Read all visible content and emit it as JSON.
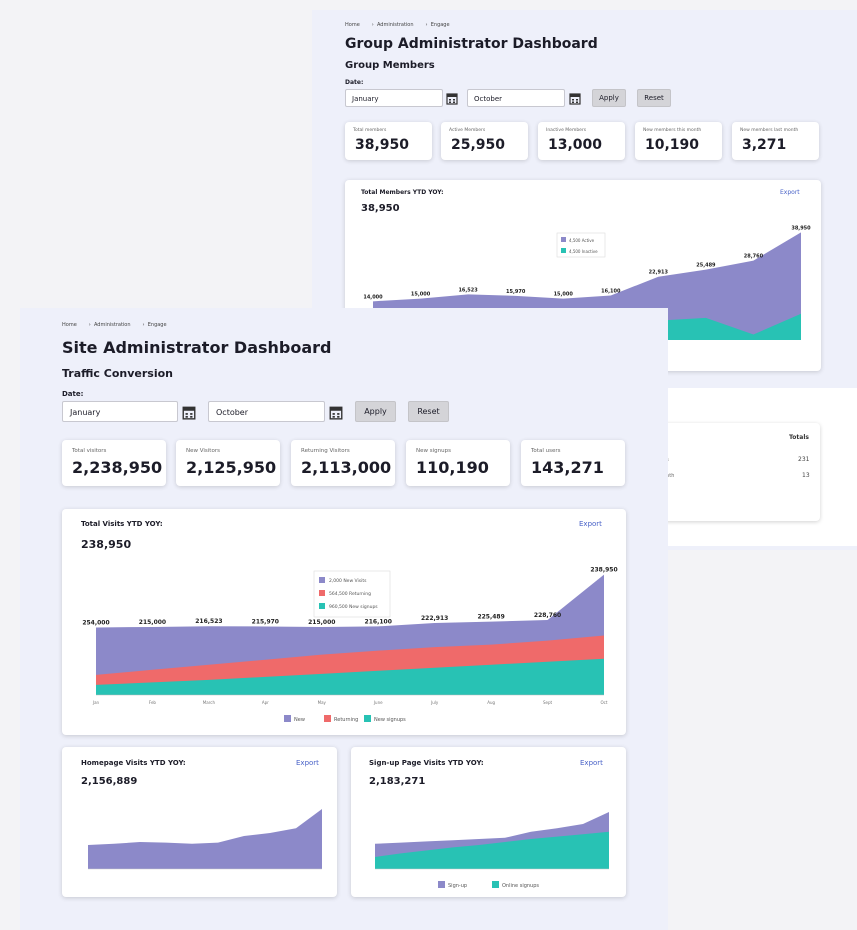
{
  "colors": {
    "purple": "#8c89c9",
    "red": "#ef6a6a",
    "teal": "#28c2b4",
    "link": "#4a63c8"
  },
  "back": {
    "breadcrumb": [
      "Home",
      "Administration",
      "Engage"
    ],
    "title": "Group Administrator Dashboard",
    "subtitle": "Group Members",
    "date_label": "Date:",
    "from": "January",
    "to": "October",
    "apply": "Apply",
    "reset": "Reset",
    "stats": [
      {
        "label": "Total members",
        "value": "38,950"
      },
      {
        "label": "Active Members",
        "value": "25,950"
      },
      {
        "label": "Inactive Members",
        "value": "13,000"
      },
      {
        "label": "New members this month",
        "value": "10,190"
      },
      {
        "label": "New members last month",
        "value": "3,271"
      }
    ],
    "chart_card": {
      "title": "Total Members YTD YOY:",
      "value": "38,950",
      "export": "Export"
    },
    "totals": {
      "header": "Totals",
      "row1": "231",
      "row2": "13",
      "row1_label": "ns",
      "row2_label": "onth"
    }
  },
  "front": {
    "breadcrumb": [
      "Home",
      "Administration",
      "Engage"
    ],
    "title": "Site Administrator Dashboard",
    "subtitle": "Traffic Conversion",
    "date_label": "Date:",
    "from": "January",
    "to": "October",
    "apply": "Apply",
    "reset": "Reset",
    "stats": [
      {
        "label": "Total visitors",
        "value": "2,238,950"
      },
      {
        "label": "New Visitors",
        "value": "2,125,950"
      },
      {
        "label": "Returning Visitors",
        "value": "2,113,000"
      },
      {
        "label": "New signups",
        "value": "110,190"
      },
      {
        "label": "Total users",
        "value": "143,271"
      }
    ],
    "main_card": {
      "title": "Total Visits YTD YOY:",
      "value": "238,950",
      "export": "Export"
    },
    "home_card": {
      "title": "Homepage Visits YTD YOY:",
      "value": "2,156,889",
      "export": "Export"
    },
    "signup_card": {
      "title": "Sign-up Page Visits YTD YOY:",
      "value": "2,183,271",
      "export": "Export"
    }
  },
  "chart_data": [
    {
      "type": "area",
      "title": "Total Members YTD YOY:",
      "x": [
        "",
        "",
        "",
        "",
        "",
        "",
        "",
        "",
        "",
        ""
      ],
      "series": [
        {
          "values": [
            14000,
            15000,
            16523,
            15970,
            15000,
            16100,
            22913,
            25489,
            28760,
            38950
          ]
        },
        {
          "values": [
            4000,
            4500,
            5200,
            5000,
            4800,
            6000,
            7000,
            8000,
            2000,
            9500
          ]
        }
      ],
      "data_labels": [
        "14,000",
        "15,000",
        "16,523",
        "15,970",
        "15,000",
        "16,100",
        "22,913",
        "25,489",
        "28,760",
        "38,950"
      ],
      "legend": [
        "4,500 Active",
        "4,500 Inactive"
      ],
      "legend_position": "top-center",
      "ylim": [
        0,
        42000
      ]
    },
    {
      "type": "area",
      "title": "Total Visits YTD YOY:",
      "x": [
        "Jan",
        "Feb",
        "March",
        "Apr",
        "May",
        "June",
        "July",
        "Aug",
        "Sept",
        "Oct"
      ],
      "series": [
        {
          "name": "New",
          "values": [
            134000,
            135000,
            136523,
            135970,
            135000,
            136100,
            142913,
            145489,
            148760,
            238950
          ]
        },
        {
          "name": "Returning",
          "values": [
            40000,
            50000,
            60000,
            70000,
            80000,
            88000,
            95000,
            100000,
            108000,
            118000
          ]
        },
        {
          "name": "New signups",
          "values": [
            20000,
            25000,
            30000,
            36000,
            42000,
            48000,
            54000,
            60000,
            66000,
            72000
          ]
        }
      ],
      "data_labels": [
        "254,000",
        "215,000",
        "216,523",
        "215,970",
        "215,000",
        "216,100",
        "222,913",
        "225,489",
        "228,760",
        "238,950"
      ],
      "legend_box": [
        "2,000 New Visits",
        "564,500 Returning",
        "960,500 New signups"
      ],
      "legend": [
        "New",
        "Returning",
        "New signups"
      ],
      "legend_position": "bottom",
      "ylim": [
        0,
        250000
      ],
      "grid": false
    },
    {
      "type": "area",
      "title": "Homepage Visits YTD YOY:",
      "x": [
        "",
        "",
        "",
        "",
        "",
        "",
        "",
        "",
        "",
        ""
      ],
      "series": [
        {
          "values": [
            40,
            42,
            45,
            44,
            42,
            44,
            55,
            60,
            68,
            100
          ]
        }
      ],
      "ylim": [
        0,
        110
      ]
    },
    {
      "type": "area",
      "title": "Sign-up Page Visits YTD YOY:",
      "x": [
        "",
        "",
        "",
        "",
        "",
        "",
        "",
        "",
        "",
        ""
      ],
      "series": [
        {
          "name": "Sign-up",
          "values": [
            42,
            44,
            46,
            48,
            50,
            52,
            62,
            68,
            75,
            95
          ]
        },
        {
          "name": "Online signups",
          "values": [
            20,
            26,
            31,
            36,
            40,
            45,
            50,
            54,
            58,
            62
          ]
        }
      ],
      "legend": [
        "Sign-up",
        "Online signups"
      ],
      "legend_position": "bottom",
      "ylim": [
        0,
        110
      ]
    }
  ]
}
